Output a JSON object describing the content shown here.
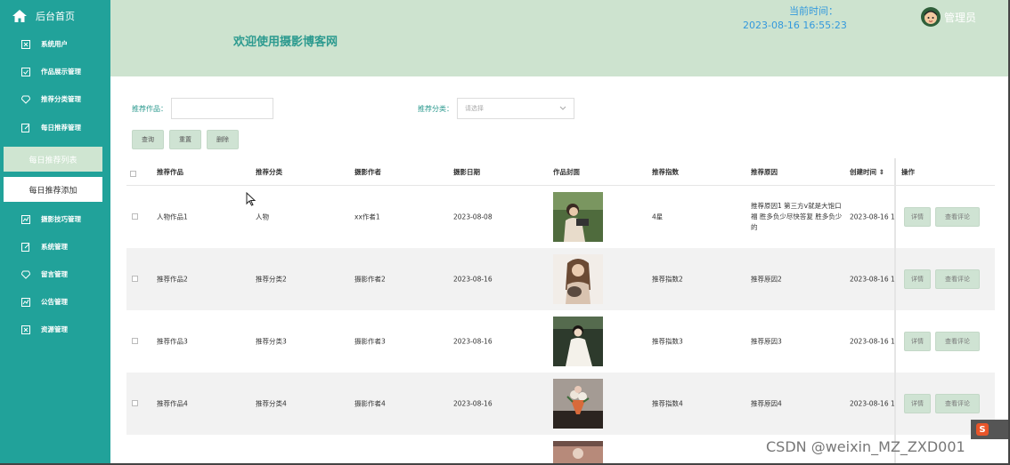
{
  "sidebar": {
    "home_label": "后台首页",
    "items": [
      {
        "label": "系统用户",
        "icon": "user-card-icon"
      },
      {
        "label": "作品展示管理",
        "icon": "checkbox-icon"
      },
      {
        "label": "推荐分类管理",
        "icon": "diamond-icon"
      },
      {
        "label": "每日推荐管理",
        "icon": "edit-icon"
      }
    ],
    "sub_items": [
      {
        "label": "每日推荐列表",
        "active": true
      },
      {
        "label": "每日推荐添加",
        "active": false
      }
    ],
    "items2": [
      {
        "label": "摄影技巧管理",
        "icon": "chart-icon"
      },
      {
        "label": "系统管理",
        "icon": "edit-icon"
      },
      {
        "label": "留言管理",
        "icon": "diamond-icon"
      },
      {
        "label": "公告管理",
        "icon": "chart-icon"
      },
      {
        "label": "资源管理",
        "icon": "user-card-icon"
      }
    ]
  },
  "header": {
    "title": "欢迎使用摄影博客网",
    "time_label": "当前时间：",
    "time_value": "2023-08-16 16:55:23",
    "admin_label": "管理员"
  },
  "search": {
    "work_label": "推荐作品：",
    "category_label": "推荐分类：",
    "category_placeholder": "请选择",
    "buttons": [
      "查询",
      "重置",
      "删除"
    ]
  },
  "table": {
    "headers": [
      "推荐作品",
      "推荐分类",
      "摄影作者",
      "摄影日期",
      "作品封面",
      "推荐指数",
      "推荐原因",
      "创建时间 ⇕",
      "操作"
    ],
    "rows": [
      {
        "work": "人物作品1",
        "category": "人物",
        "author": "xx作者1",
        "date": "2023-08-08",
        "index": "4星",
        "reason": "推荐原因1 第三方v就是大饱口福 胜多负少尽快答复 胜多负少的",
        "created": "2023-08-16 1"
      },
      {
        "work": "推荐作品2",
        "category": "推荐分类2",
        "author": "摄影作者2",
        "date": "2023-08-16",
        "index": "推荐指数2",
        "reason": "推荐原因2",
        "created": "2023-08-16 1"
      },
      {
        "work": "推荐作品3",
        "category": "推荐分类3",
        "author": "摄影作者3",
        "date": "2023-08-16",
        "index": "推荐指数3",
        "reason": "推荐原因3",
        "created": "2023-08-16 1"
      },
      {
        "work": "推荐作品4",
        "category": "推荐分类4",
        "author": "摄影作者4",
        "date": "2023-08-16",
        "index": "推荐指数4",
        "reason": "推荐原因4",
        "created": "2023-08-16 1"
      }
    ],
    "row_buttons": {
      "detail": "详情",
      "comments": "查看评论"
    }
  },
  "watermark": "CSDN @weixin_MZ_ZXD001",
  "ime_label": "S",
  "colors": {
    "sidebar": "#21a29a",
    "header": "#cde3cf",
    "accent": "#2c9a8f",
    "time": "#3399dd"
  }
}
